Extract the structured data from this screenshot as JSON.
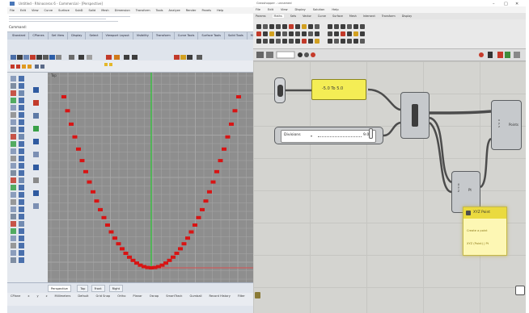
{
  "rhino": {
    "window_title": "Untitled - Rhinoceros 6 - Commercial - [Perspective]",
    "menu": [
      "File",
      "Edit",
      "View",
      "Curve",
      "Surface",
      "SubD",
      "Solid",
      "Mesh",
      "Dimension",
      "Transform",
      "Tools",
      "Analyze",
      "Render",
      "Panels",
      "Help"
    ],
    "command_label": "Command:",
    "toolbar_tabs": [
      "Standard",
      "CPlanes",
      "Set View",
      "Display",
      "Select",
      "Viewport Layout",
      "Visibility",
      "Transform",
      "Curve Tools",
      "Surface Tools",
      "Solid Tools",
      "Mesh Tools",
      "Render Tools",
      "Drafting"
    ],
    "viewport_label": "Top",
    "viewport_tabs": [
      "Perspective",
      "Top",
      "Front",
      "Right"
    ],
    "active_viewport_tab": 0,
    "status_items": [
      "CPlane",
      "x",
      "y",
      "z",
      "Millimeters",
      "Default",
      "Grid Snap",
      "Ortho",
      "Planar",
      "Osnap",
      "SmartTrack",
      "Gumball",
      "Record History",
      "Filter"
    ],
    "colors": {
      "points": "#d81414",
      "viewport_bg": "#8e8e8e",
      "grid": "#a6a6a6",
      "y_axis": "#3fbf47",
      "x_axis": "#d94d4d"
    }
  },
  "grasshopper": {
    "window_title": "Grasshopper - unnamed",
    "menu": [
      "File",
      "Edit",
      "View",
      "Display",
      "Solution",
      "Help"
    ],
    "tabs": [
      "Params",
      "Maths",
      "Sets",
      "Vector",
      "Curve",
      "Surface",
      "Mesh",
      "Intersect",
      "Transform",
      "Display"
    ],
    "selected_tab": 1,
    "expression_panel": "-5.0 To 5.0",
    "slider": {
      "name": "Divisions",
      "value": "9.0"
    },
    "points_node_label": "Pt",
    "output_node_label": "Points",
    "tooltip": {
      "title": "XYZ Point",
      "rows": [
        "Create a point",
        "XYZ (Point) | Pt"
      ]
    },
    "colors": {
      "canvas": "#d4d4d0",
      "panel": "#f4ed55",
      "wire": "#4c4c4c"
    }
  }
}
